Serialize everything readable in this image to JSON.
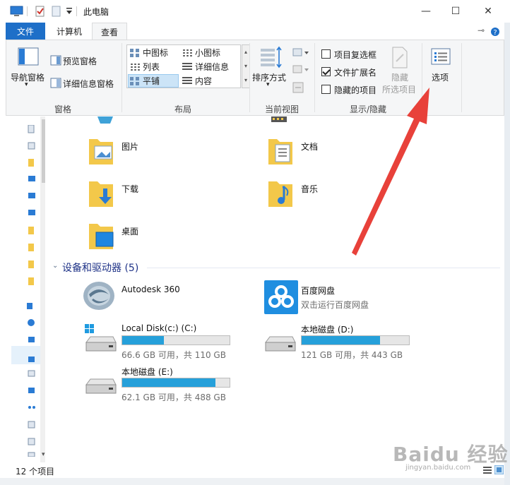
{
  "window": {
    "title": "此电脑",
    "minimize": "—",
    "maximize": "☐",
    "close": "✕"
  },
  "tabs": {
    "file": "文件",
    "computer": "计算机",
    "view": "查看"
  },
  "ribbon": {
    "panes": {
      "nav_pane": "导航窗格",
      "preview_pane": "预览窗格",
      "details_pane": "详细信息窗格",
      "group_label": "窗格"
    },
    "layout": {
      "items": [
        "中图标",
        "小图标",
        "列表",
        "详细信息",
        "平铺",
        "内容"
      ],
      "group_label": "布局"
    },
    "current_view": {
      "sort": "排序方式",
      "group_label": "当前视图"
    },
    "show_hide": {
      "item_checkboxes": "项目复选框",
      "file_extensions": "文件扩展名",
      "hidden_items": "隐藏的项目",
      "hide_label_1": "隐藏",
      "hide_label_2": "所选项目",
      "group_label": "显示/隐藏"
    },
    "options": "选项"
  },
  "folders": [
    {
      "name": "图片"
    },
    {
      "name": "文档"
    },
    {
      "name": "下载"
    },
    {
      "name": "音乐"
    },
    {
      "name": "桌面"
    }
  ],
  "devices": {
    "header": "设备和驱动器 (5)",
    "items": [
      {
        "name": "Autodesk 360"
      },
      {
        "name": "百度网盘",
        "sub": "双击运行百度网盘"
      },
      {
        "name": "Local Disk(c:) (C:)",
        "sub": "66.6 GB 可用，共 110 GB",
        "fill": 0.39
      },
      {
        "name": "本地磁盘 (D:)",
        "sub": "121 GB 可用，共 443 GB",
        "fill": 0.73
      },
      {
        "name": "本地磁盘 (E:)",
        "sub": "62.1 GB 可用，共 488 GB",
        "fill": 0.87
      }
    ]
  },
  "status": {
    "count": "12 个项目"
  },
  "watermark": {
    "line1": "Baidu 经验",
    "line2": "jingyan.baidu.com"
  },
  "colors": {
    "accent": "#1e6fc8",
    "bar_fill": "#26a0da",
    "folder": "#f3c84a",
    "arrow": "#e8413a",
    "section_header": "#1e3287"
  }
}
